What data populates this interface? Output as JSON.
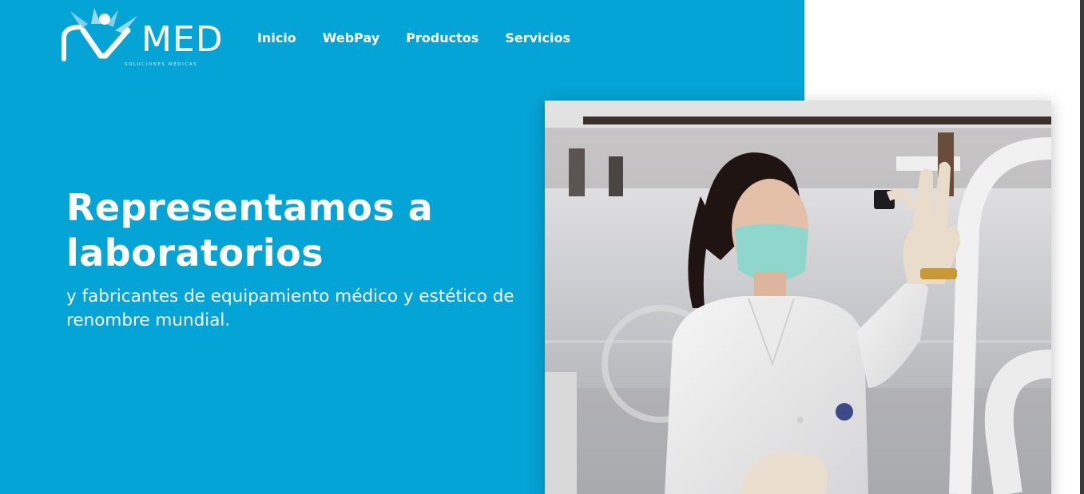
{
  "brand": {
    "name": "MED",
    "tagline": "SOLUCIONES MÉDICAS",
    "color_primary": "#05a4d6"
  },
  "nav": {
    "items": [
      {
        "label": "Inicio"
      },
      {
        "label": "WebPay"
      },
      {
        "label": "Productos"
      },
      {
        "label": "Servicios"
      }
    ]
  },
  "hero": {
    "title_line1": "Representamos a",
    "title_line2": "laboratorios",
    "subtitle": "y fabricantes de equipamiento médico y estético de renombre mundial.",
    "photo": "scientist-holding-sample-photo"
  }
}
